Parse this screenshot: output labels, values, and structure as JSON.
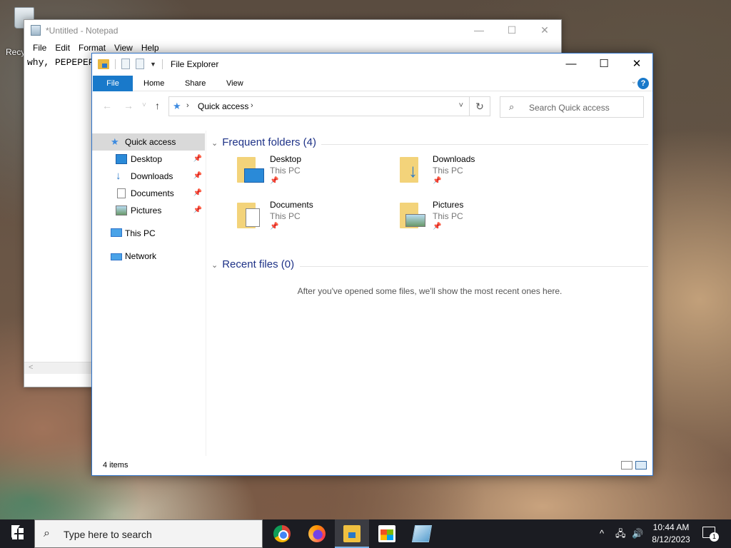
{
  "desktop": {
    "recycle_bin_label": "Recy"
  },
  "notepad": {
    "title": "*Untitled - Notepad",
    "menu": [
      "File",
      "Edit",
      "Format",
      "View",
      "Help"
    ],
    "content": "why, PEPEPEP",
    "minimize": "—",
    "maximize": "☐",
    "close": "✕",
    "scroll_left": "<"
  },
  "explorer": {
    "title": "File Explorer",
    "window_buttons": {
      "minimize": "—",
      "maximize": "☐",
      "close": "✕"
    },
    "ribbon_tabs": [
      "File",
      "Home",
      "Share",
      "View"
    ],
    "help_label": "?",
    "address": {
      "current": "Quick access",
      "back": "←",
      "forward": "→",
      "recent": "˅",
      "up": "↑",
      "refresh": "↻",
      "dropdown": "˅"
    },
    "search_placeholder": "Search Quick access",
    "nav_pane": [
      {
        "label": "Quick access",
        "icon": "star-icon",
        "pinned": false,
        "selected": true
      },
      {
        "label": "Desktop",
        "icon": "desktop-icon",
        "pinned": true
      },
      {
        "label": "Downloads",
        "icon": "download-icon",
        "pinned": true
      },
      {
        "label": "Documents",
        "icon": "documents-icon",
        "pinned": true
      },
      {
        "label": "Pictures",
        "icon": "pictures-icon",
        "pinned": true
      },
      {
        "label": "This PC",
        "icon": "computer-icon",
        "pinned": false
      },
      {
        "label": "Network",
        "icon": "network-icon",
        "pinned": false
      }
    ],
    "frequent_header": "Frequent folders (4)",
    "frequent_folders": [
      {
        "name": "Desktop",
        "location": "This PC"
      },
      {
        "name": "Downloads",
        "location": "This PC"
      },
      {
        "name": "Documents",
        "location": "This PC"
      },
      {
        "name": "Pictures",
        "location": "This PC"
      }
    ],
    "recent_header": "Recent files (0)",
    "recent_empty": "After you've opened some files, we'll show the most recent ones here.",
    "status": "4 items"
  },
  "taskbar": {
    "search_placeholder": "Type here to search",
    "apps": [
      "Google Chrome",
      "Firefox",
      "File Explorer",
      "Microsoft Store",
      "Notepad"
    ],
    "time": "10:44 AM",
    "date": "8/12/2023",
    "notification_count": "1"
  },
  "colors": {
    "accent": "#1979ca",
    "group_header": "#1e3287",
    "taskbar": "#1b1c22"
  }
}
